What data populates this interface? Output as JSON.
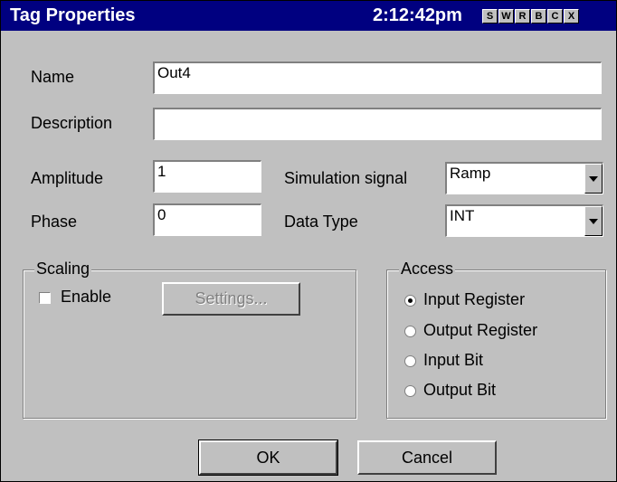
{
  "window": {
    "title": "Tag Properties",
    "time": "2:12:42pm",
    "title_buttons": [
      "S",
      "W",
      "R",
      "B",
      "C",
      "X"
    ]
  },
  "form": {
    "name_label": "Name",
    "name_value": "Out4",
    "description_label": "Description",
    "description_value": "",
    "amplitude_label": "Amplitude",
    "amplitude_value": "1",
    "phase_label": "Phase",
    "phase_value": "0",
    "simulation_label": "Simulation signal",
    "simulation_value": "Ramp",
    "datatype_label": "Data Type",
    "datatype_value": "INT"
  },
  "scaling": {
    "group_label": "Scaling",
    "enable_label": "Enable",
    "enable_checked": false,
    "settings_label": "Settings..."
  },
  "access": {
    "group_label": "Access",
    "options": [
      "Input Register",
      "Output Register",
      "Input Bit",
      "Output Bit"
    ],
    "selected": "Input Register"
  },
  "buttons": {
    "ok": "OK",
    "cancel": "Cancel"
  },
  "colors": {
    "titlebar": "#000080",
    "dialog_bg": "#c0c0c0"
  }
}
